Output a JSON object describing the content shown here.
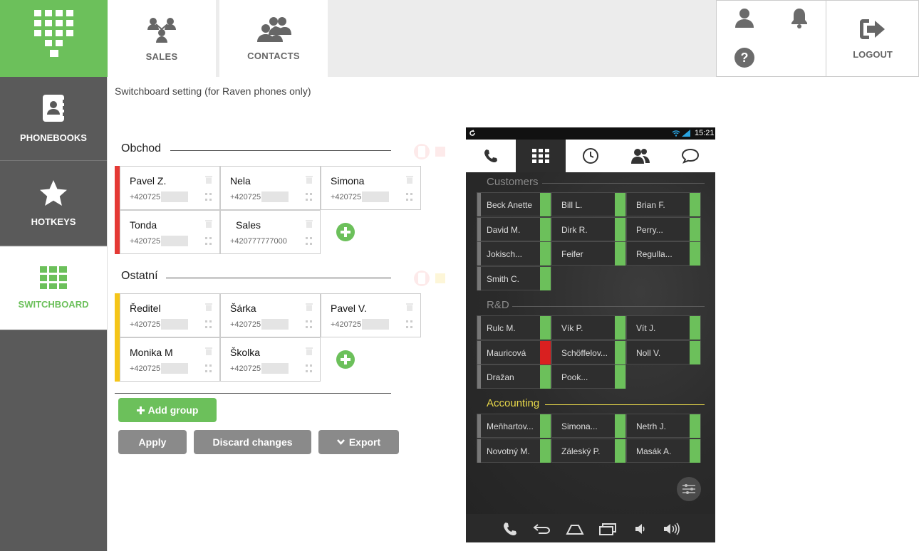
{
  "header": {
    "tabs": [
      {
        "label": "SALES",
        "icon": "people-network-icon"
      },
      {
        "label": "CONTACTS",
        "icon": "contacts-group-icon"
      }
    ],
    "logout_label": "LOGOUT"
  },
  "sidebar": {
    "items": [
      {
        "label": "PHONEBOOKS",
        "icon": "phonebook-icon"
      },
      {
        "label": "HOTKEYS",
        "icon": "star-icon"
      },
      {
        "label": "SWITCHBOARD",
        "icon": "grid-icon",
        "active": true
      }
    ]
  },
  "page": {
    "title": "Switchboard setting (for Raven phones only)"
  },
  "groups": [
    {
      "name": "Obchod",
      "color": "#e53935",
      "contacts": [
        {
          "name": "Pavel Z.",
          "phone": "+420725"
        },
        {
          "name": "Nela",
          "phone": "+420725"
        },
        {
          "name": "Simona",
          "phone": "+420725"
        },
        {
          "name": "Tonda",
          "phone": "+420725"
        },
        {
          "name": "Sales",
          "phone": "+420777777000"
        }
      ]
    },
    {
      "name": "Ostatní",
      "color": "#f5c518",
      "contacts": [
        {
          "name": "Ředitel",
          "phone": "+420725"
        },
        {
          "name": "Šárka",
          "phone": "+420725"
        },
        {
          "name": "Pavel V.",
          "phone": "+420725"
        },
        {
          "name": "Monika M",
          "phone": "+420725"
        },
        {
          "name": "Školka",
          "phone": "+420725"
        }
      ]
    }
  ],
  "buttons": {
    "add_group": "Add group",
    "apply": "Apply",
    "discard": "Discard changes",
    "export": "Export"
  },
  "phone": {
    "time": "15:21",
    "sections": [
      {
        "name": "Customers",
        "highlight": false,
        "contacts": [
          {
            "name": "Beck Anette",
            "status": "green"
          },
          {
            "name": "Bill L.",
            "status": "green"
          },
          {
            "name": "Brian F.",
            "status": "green"
          },
          {
            "name": "David M.",
            "status": "green"
          },
          {
            "name": "Dirk R.",
            "status": "green"
          },
          {
            "name": "Perry...",
            "status": "green"
          },
          {
            "name": "Jokisch...",
            "status": "green"
          },
          {
            "name": "Feifer",
            "status": "green"
          },
          {
            "name": "Regulla...",
            "status": "green"
          },
          {
            "name": "Smith C.",
            "status": "green"
          }
        ]
      },
      {
        "name": "R&D",
        "highlight": false,
        "contacts": [
          {
            "name": "Rulc M.",
            "status": "green"
          },
          {
            "name": "Vík P.",
            "status": "green"
          },
          {
            "name": "Vít J.",
            "status": "green"
          },
          {
            "name": "Mauricová",
            "status": "red"
          },
          {
            "name": "Schöffelov...",
            "status": "green"
          },
          {
            "name": "Noll V.",
            "status": "green"
          },
          {
            "name": "Dražan",
            "status": "green"
          },
          {
            "name": "Pook...",
            "status": "green"
          }
        ]
      },
      {
        "name": "Accounting",
        "highlight": true,
        "contacts": [
          {
            "name": "Meňhartov...",
            "status": "green"
          },
          {
            "name": "Simona...",
            "status": "green"
          },
          {
            "name": "Netrh J.",
            "status": "green"
          },
          {
            "name": "Novotný M.",
            "status": "green"
          },
          {
            "name": "Záleský P.",
            "status": "green"
          },
          {
            "name": "Masák A.",
            "status": "green"
          }
        ]
      }
    ]
  }
}
